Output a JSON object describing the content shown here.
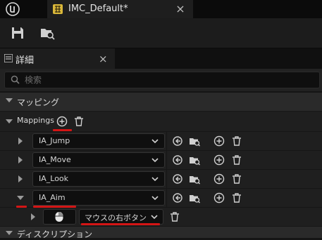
{
  "tab": {
    "title": "IMC_Default*",
    "close": "×"
  },
  "details": {
    "title": "詳細",
    "close": "×"
  },
  "search": {
    "placeholder": "検索"
  },
  "sections": {
    "mapping": "マッピング",
    "description": "ディスクリプション"
  },
  "mappings": {
    "label": "Mappings",
    "items": [
      {
        "action": "IA_Jump",
        "expanded": false
      },
      {
        "action": "IA_Move",
        "expanded": false
      },
      {
        "action": "IA_Look",
        "expanded": false
      },
      {
        "action": "IA_Aim",
        "expanded": true
      }
    ],
    "key": {
      "label": "マウスの右ボタン",
      "icon": "mouse-icon"
    }
  },
  "annotation_color": "#d41515",
  "icons": [
    "unreal-logo-icon",
    "input-mapping-asset-icon",
    "save-icon",
    "browse-asset-icon",
    "details-icon",
    "search-icon",
    "add-icon",
    "trash-icon",
    "chevron-down-icon",
    "reset-arrow-icon",
    "browse-icon",
    "mouse-icon"
  ]
}
